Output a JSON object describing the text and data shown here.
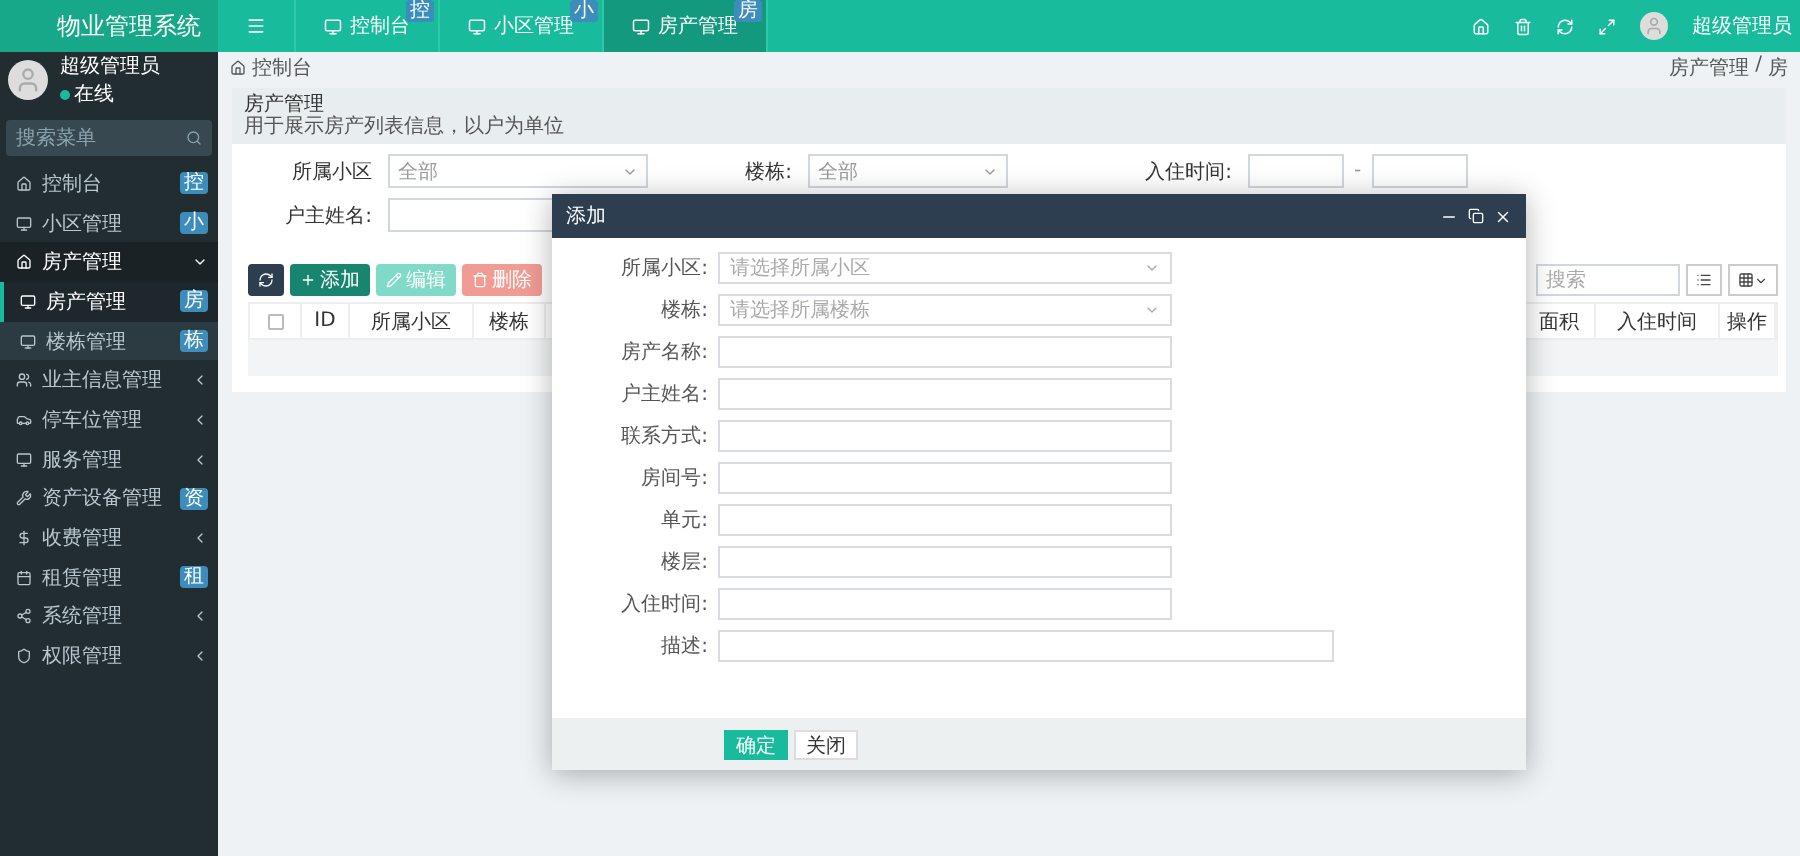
{
  "logo": {
    "title": "物业管理系统"
  },
  "top_tabs": [
    {
      "label": "控制台",
      "badge": "控",
      "selected": false
    },
    {
      "label": "小区管理",
      "badge": "小",
      "selected": false
    },
    {
      "label": "房产管理",
      "badge": "房",
      "selected": true
    }
  ],
  "user": {
    "name": "超级管理员",
    "status": "在线"
  },
  "top_user": {
    "name": "超级管理员"
  },
  "sidebar": {
    "search_placeholder": "搜索菜单",
    "items": [
      {
        "label": "控制台",
        "badge": "控",
        "expanded": false
      },
      {
        "label": "小区管理",
        "badge": "小",
        "expanded": false
      },
      {
        "label": "房产管理",
        "expanded": true,
        "children": [
          {
            "label": "房产管理",
            "badge": "房",
            "selected": true
          },
          {
            "label": "楼栋管理",
            "badge": "栋",
            "selected": false
          }
        ]
      },
      {
        "label": "业主信息管理",
        "expanded": false
      },
      {
        "label": "停车位管理",
        "expanded": false
      },
      {
        "label": "服务管理",
        "expanded": false
      },
      {
        "label": "资产设备管理",
        "badge": "资",
        "expanded": false
      },
      {
        "label": "收费管理",
        "expanded": false
      },
      {
        "label": "租赁管理",
        "badge": "租",
        "expanded": false
      },
      {
        "label": "系统管理",
        "expanded": false
      },
      {
        "label": "权限管理",
        "expanded": false
      }
    ]
  },
  "breadcrumb": {
    "home": "控制台",
    "trail": [
      "房产管理",
      "房"
    ],
    "separator": "/"
  },
  "panel": {
    "title": "房产管理",
    "description": "用于展示房产列表信息，以户为单位"
  },
  "filters": [
    {
      "label": "所属小区",
      "value": "全部",
      "kind": "select"
    },
    {
      "label": "楼栋:",
      "value": "全部",
      "kind": "select"
    },
    {
      "label": "入住时间:",
      "kind": "range",
      "separator": "-"
    },
    {
      "label": "户主姓名:",
      "kind": "text"
    }
  ],
  "toolbar": {
    "buttons": [
      {
        "kind": "refresh",
        "disabled": false
      },
      {
        "label": "添加",
        "kind": "add",
        "disabled": false
      },
      {
        "label": "编辑",
        "kind": "edit",
        "disabled": true
      },
      {
        "label": "删除",
        "kind": "delete",
        "disabled": true
      }
    ],
    "search_placeholder": "搜索"
  },
  "table": {
    "select_all_checked": false,
    "left_columns": [
      "ID",
      "所属小区",
      "楼栋"
    ],
    "right_columns": [
      "面积",
      "入住时间",
      "操作"
    ]
  },
  "dialog": {
    "title": "添加",
    "fields": [
      {
        "label": "所属小区:",
        "kind": "select",
        "placeholder": "请选择所属小区"
      },
      {
        "label": "楼栋:",
        "kind": "select",
        "placeholder": "请选择所属楼栋"
      },
      {
        "label": "房产名称:",
        "kind": "text"
      },
      {
        "label": "户主姓名:",
        "kind": "text"
      },
      {
        "label": "联系方式:",
        "kind": "text"
      },
      {
        "label": "房间号:",
        "kind": "text"
      },
      {
        "label": "单元:",
        "kind": "text"
      },
      {
        "label": "楼层:",
        "kind": "text"
      },
      {
        "label": "入住时间:",
        "kind": "text"
      },
      {
        "label": "描述:",
        "kind": "wide"
      }
    ],
    "buttons": [
      {
        "label": "确定",
        "primary": true
      },
      {
        "label": "关闭",
        "primary": false
      }
    ]
  }
}
